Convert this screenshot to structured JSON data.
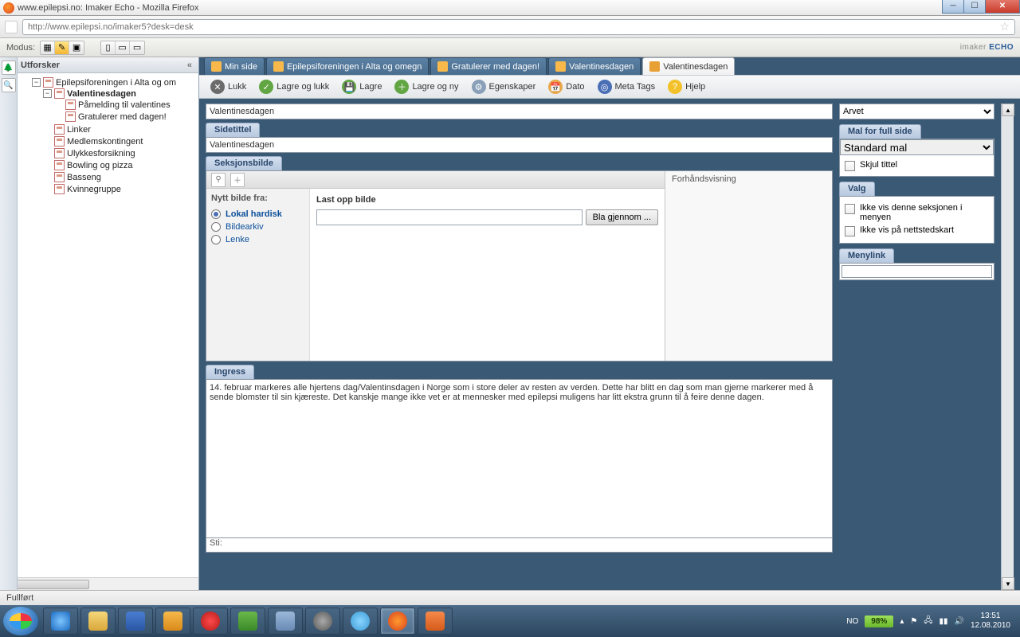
{
  "window": {
    "title": "www.epilepsi.no: Imaker Echo - Mozilla Firefox"
  },
  "url": "http://www.epilepsi.no/imaker5?desk=desk",
  "modus": {
    "label": "Modus:"
  },
  "brand": {
    "text_a": "imaker",
    "text_b": "ECHO"
  },
  "sidebar": {
    "title": "Utforsker",
    "tree": [
      {
        "label": "Epilepsiforeningen i Alta og om",
        "exp": "-",
        "children": [
          {
            "label": "Valentinesdagen",
            "bold": true,
            "exp": "-",
            "children": [
              {
                "label": "Påmelding til valentines"
              },
              {
                "label": "Gratulerer med dagen!"
              }
            ]
          },
          {
            "label": "Linker"
          },
          {
            "label": "Medlemskontingent"
          },
          {
            "label": "Ulykkesforsikning"
          },
          {
            "label": "Bowling og pizza"
          },
          {
            "label": "Basseng"
          },
          {
            "label": "Kvinnegruppe"
          }
        ]
      }
    ]
  },
  "tabs": [
    {
      "label": "Min side"
    },
    {
      "label": "Epilepsiforeningen i Alta og omegn"
    },
    {
      "label": "Gratulerer med dagen!"
    },
    {
      "label": "Valentinesdagen"
    },
    {
      "label": "Valentinesdagen",
      "active": true
    }
  ],
  "toolbar": {
    "close": "Lukk",
    "save_close": "Lagre og lukk",
    "save": "Lagre",
    "save_new": "Lagre og ny",
    "props": "Egenskaper",
    "date": "Dato",
    "meta": "Meta Tags",
    "help": "Hjelp"
  },
  "fields": {
    "title_val": "Valentinesdagen",
    "sidetittel_label": "Sidetittel",
    "sidetittel_val": "Valentinesdagen",
    "seksjonsbilde_label": "Seksjonsbilde",
    "preview_label": "Forhåndsvisning",
    "nytt_bilde": "Nytt bilde fra:",
    "opt_local": "Lokal hardisk",
    "opt_arkiv": "Bildearkiv",
    "opt_lenke": "Lenke",
    "upload_title": "Last opp bilde",
    "browse_btn": "Bla gjennom ...",
    "ingress_label": "Ingress",
    "ingress_text": "14. februar markeres alle hjertens dag/Valentinsdagen i Norge som i store deler av resten av verden. Dette har blitt en dag som man gjerne markerer med å sende blomster til sin kjæreste. Det kanskje mange ikke vet er at mennesker med epilepsi muligens har litt ekstra grunn til å feire denne dagen.",
    "sti_label": "Sti:"
  },
  "side": {
    "arvet": "Arvet",
    "mal_label": "Mal for full side",
    "mal_val": "Standard mal",
    "skjul": "Skjul tittel",
    "valg_label": "Valg",
    "opt1": "Ikke vis denne seksjonen i menyen",
    "opt2": "Ikke vis på nettstedskart",
    "menylink_label": "Menylink"
  },
  "status": {
    "text": "Fullført"
  },
  "tray": {
    "lang": "NO",
    "batt": "98%",
    "time": "13:51",
    "date": "12.08.2010"
  }
}
